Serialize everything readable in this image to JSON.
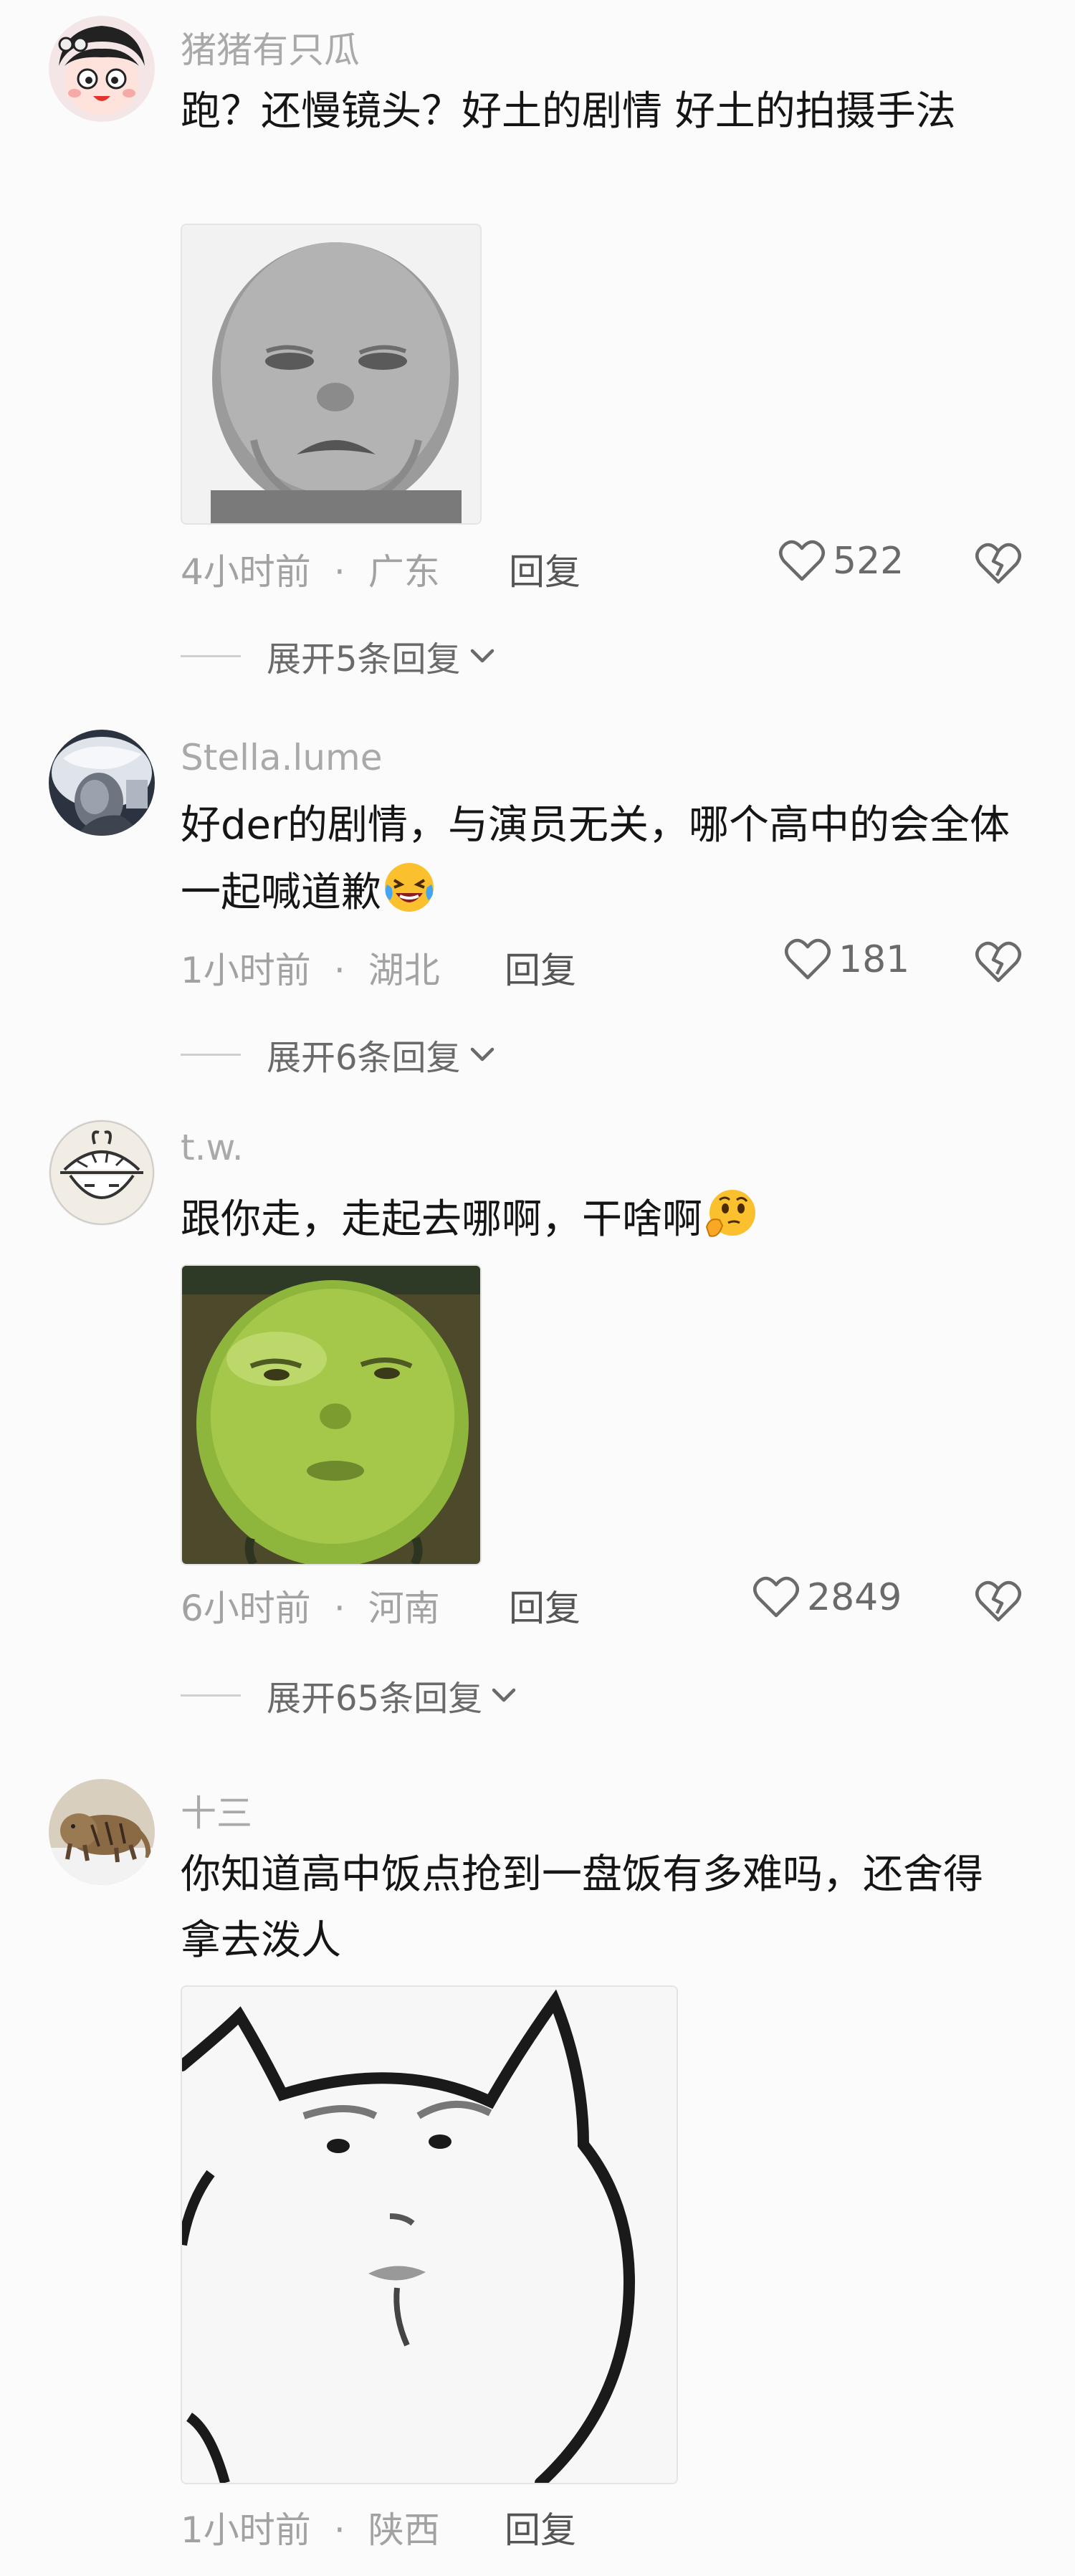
{
  "comments": [
    {
      "username": "猪猪有只瓜",
      "text": "跑？还慢镜头？好土的剧情 好土的拍摄手法",
      "time": "4小时前",
      "location": "广东",
      "reply_label": "回复",
      "likes": "522",
      "expand_label": "展开5条回复"
    },
    {
      "username": "Stella.lume",
      "text": "好der的剧情，与演员无关，哪个高中的会全体一起喊道歉",
      "time": "1小时前",
      "location": "湖北",
      "reply_label": "回复",
      "likes": "181",
      "expand_label": "展开6条回复"
    },
    {
      "username": "t.w.",
      "text": "跟你走，走起去哪啊，干啥啊",
      "time": "6小时前",
      "location": "河南",
      "reply_label": "回复",
      "likes": "2849",
      "expand_label": "展开65条回复"
    },
    {
      "username": "十三",
      "text": "你知道高中饭点抢到一盘饭有多难吗，还舍得拿去泼人",
      "time": "1小时前",
      "location": "陕西",
      "reply_label": "回复"
    }
  ],
  "icons": {
    "like": "heart-outline-icon",
    "dislike": "broken-heart-icon",
    "expand": "chevron-down-icon"
  },
  "colors": {
    "background": "#fbfbfb",
    "username": "#a9a9a9",
    "meta": "#a2a2a2"
  }
}
